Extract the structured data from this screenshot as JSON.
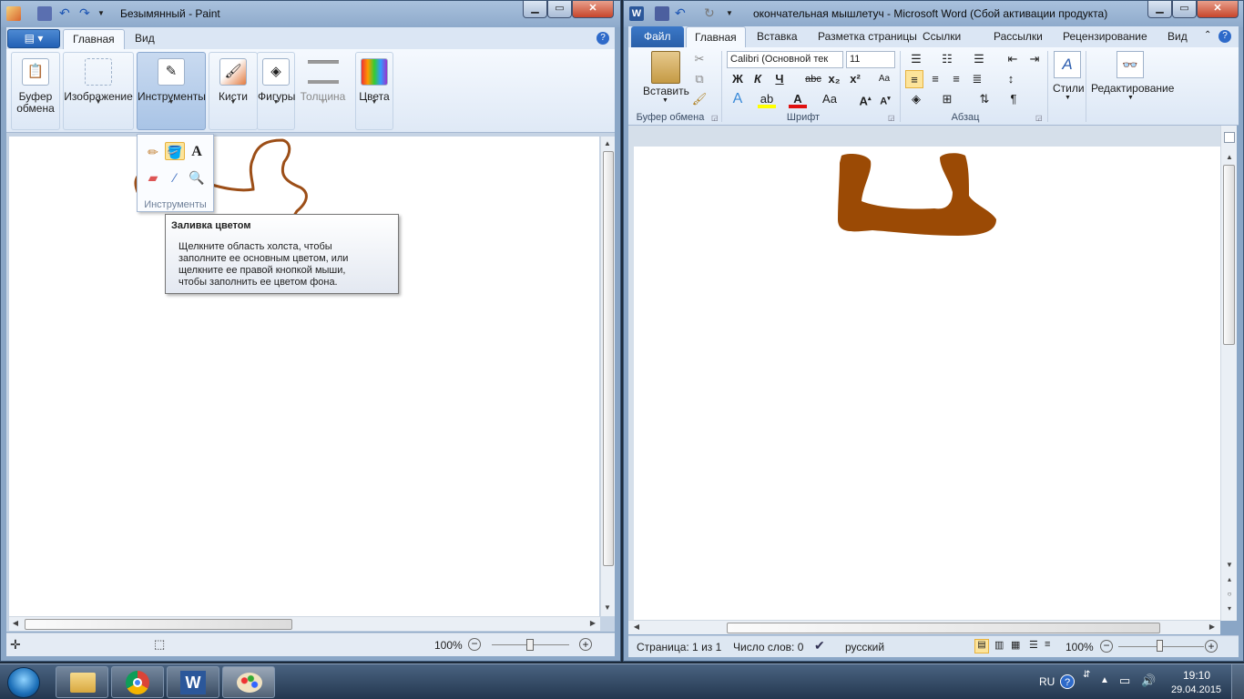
{
  "paint": {
    "title": "Безымянный - Paint",
    "tabs": [
      "Главная",
      "Вид"
    ],
    "groups": {
      "clipboard": "Буфер\nобмена",
      "image": "Изображение",
      "tools": "Инструменты",
      "brushes": "Кисти",
      "shapes": "Фигуры",
      "size": "Толщина",
      "colors": "Цвета"
    },
    "tools_dropdown": {
      "label": "Инструменты",
      "items": [
        "pencil-icon",
        "fill-icon",
        "text-icon",
        "eraser-icon",
        "color-picker-icon",
        "magnifier-icon"
      ],
      "active": "fill-icon"
    },
    "tooltip": {
      "title": "Заливка цветом",
      "body": "Щелкните область холста, чтобы\nзаполните ее основным цветом, или\nщелкните ее правой кнопкой мыши,\nчтобы заполнить ее цветом фона."
    },
    "status": {
      "zoom": "100%"
    },
    "drawing_color": "#9c4e17"
  },
  "word": {
    "title": "окончательная мышлетуч  -  Microsoft Word (Сбой активации продукта)",
    "tabs": [
      "Файл",
      "Главная",
      "Вставка",
      "Разметка страницы",
      "Ссылки",
      "Рассылки",
      "Рецензирование",
      "Вид"
    ],
    "clipboard": {
      "paste": "Вставить",
      "group": "Буфер обмена"
    },
    "font": {
      "name": "Calibri (Основной тек",
      "size": "11",
      "group": "Шрифт"
    },
    "paragraph": {
      "group": "Абзац"
    },
    "styles": "Стили",
    "editing": "Редактирование",
    "status": {
      "page": "Страница: 1 из 1",
      "words": "Число слов: 0",
      "language": "русский",
      "zoom": "100%"
    },
    "shape_color": "#9b4a05"
  },
  "taskbar": {
    "lang": "RU",
    "time": "19:10",
    "date": "29.04.2015"
  }
}
